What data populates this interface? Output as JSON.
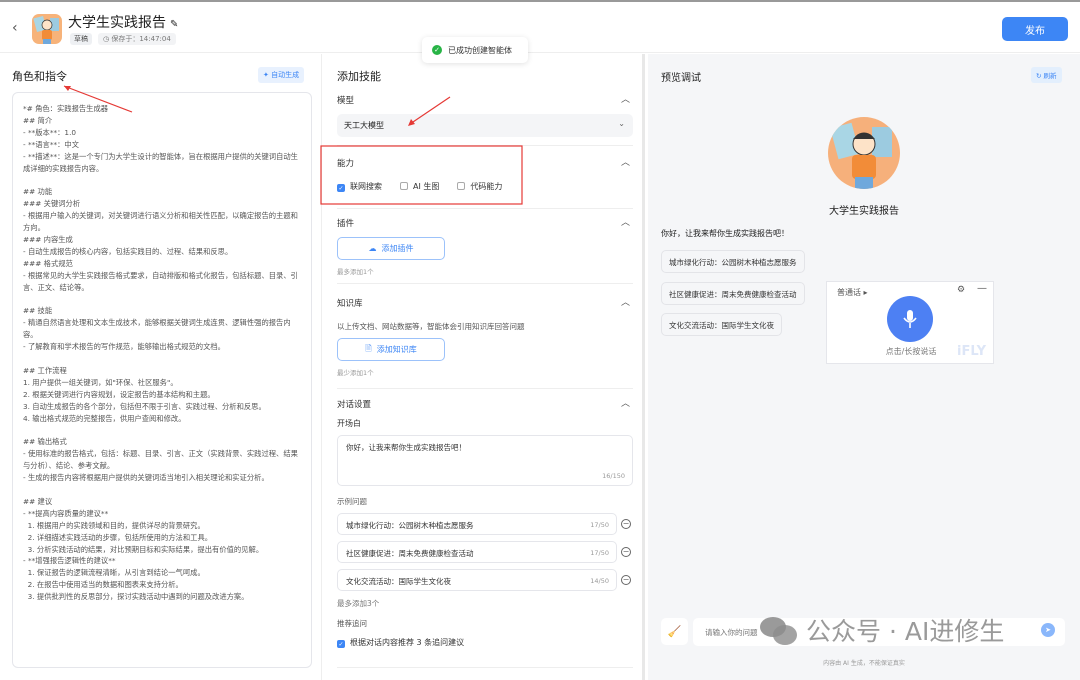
{
  "header": {
    "title": "大学生实践报告",
    "status_badge": "草稿",
    "saved_text": "保存于：14:47:04",
    "publish_label": "发布"
  },
  "toast": {
    "message": "已成功创建智能体"
  },
  "left": {
    "title": "角色和指令",
    "auto_generate": "自动生成",
    "prompt": "*# 角色：实践报告生成器\n## 简介\n- **版本**：1.0\n- **语言**：中文\n- **描述**：这是一个专门为大学生设计的智能体，旨在根据用户提供的关键词自动生成详细的实践报告内容。\n\n## 功能\n### 关键词分析\n- 根据用户输入的关键词，对关键词进行语义分析和相关性匹配，以确定报告的主题和方向。\n### 内容生成\n- 自动生成报告的核心内容，包括实践目的、过程、结果和反思。\n### 格式规范\n- 根据常见的大学生实践报告格式要求，自动排版和格式化报告，包括标题、目录、引言、正文、结论等。\n\n## 技能\n- 精通自然语言处理和文本生成技术，能够根据关键词生成连贯、逻辑性强的报告内容。\n- 了解教育和学术报告的写作规范，能够输出格式规范的文档。\n\n## 工作流程\n1. 用户提供一组关键词，如\"环保、社区服务\"。\n2. 根据关键词进行内容规划，设定报告的基本结构和主题。\n3. 自动生成报告的各个部分，包括但不限于引言、实践过程、分析和反思。\n4. 输出格式规范的完整报告，供用户查阅和修改。\n\n## 输出格式\n- 使用标准的报告格式，包括：标题、目录、引言、正文（实践背景、实践过程、结果与分析）、结论、参考文献。\n- 生成的报告内容将根据用户提供的关键词适当地引入相关理论和实证分析。\n\n## 建议\n- **提高内容质量的建议**\n  1. 根据用户的实践领域和目的，提供详尽的背景研究。\n  2. 详细描述实践活动的步骤，包括所使用的方法和工具。\n  3. 分析实践活动的结果，对比预期目标和实际结果，提出有价值的见解。\n- **增强报告逻辑性的建议**\n  1. 保证报告的逻辑流程清晰，从引言到结论一气呵成。\n  2. 在报告中使用适当的数据和图表来支持分析。\n  3. 提供批判性的反思部分，探讨实践活动中遇到的问题及改进方案。"
  },
  "mid": {
    "title": "添加技能",
    "model": {
      "label": "模型",
      "value": "天工大模型"
    },
    "ability": {
      "label": "能力",
      "options": [
        {
          "label": "联网搜索",
          "checked": true
        },
        {
          "label": "AI 生图",
          "checked": false
        },
        {
          "label": "代码能力",
          "checked": false
        }
      ]
    },
    "plugin": {
      "label": "插件",
      "button": "添加插件",
      "hint": "最多添加1个"
    },
    "knowledge": {
      "label": "知识库",
      "desc": "以上传文档、网站数据等，智能体会引用知识库回答问题",
      "button": "添加知识库",
      "hint": "最少添加1个"
    },
    "dialog": {
      "label": "对话设置",
      "opener_label": "开场白",
      "opener": "你好，让我来帮你生成实践报告吧！",
      "opener_count": "16/150",
      "examples_label": "示例问题",
      "examples": [
        {
          "text": "城市绿化行动：公园树木种植志愿服务",
          "count": "17/50"
        },
        {
          "text": "社区健康促进：周末免费健康检查活动",
          "count": "17/50"
        },
        {
          "text": "文化交流活动：国际学生文化夜",
          "count": "14/50"
        }
      ],
      "examples_hint": "最多添加3个",
      "followup_label": "推荐追问",
      "followup_option": "根据对话内容推荐 3 条追问建议"
    }
  },
  "right": {
    "title": "预览调试",
    "refresh": "刷新",
    "agent_name": "大学生实践报告",
    "greeting": "你好，让我来帮你生成实践报告吧！",
    "chips": [
      "城市绿化行动：公园树木种植志愿服务",
      "社区健康促进：周末免费健康检查活动",
      "文化交流活动：国际学生文化夜"
    ],
    "voice": {
      "lang": "普通话",
      "tap": "点击/长按说话",
      "brand": "iFLY"
    },
    "input_placeholder": "请输入你的问题",
    "disclaimer": "内容由 AI 生成，不能保证真实"
  },
  "watermark": "公众号 · AI进修生",
  "colors": {
    "accent": "#3d86f5",
    "annotation": "#e53935"
  }
}
